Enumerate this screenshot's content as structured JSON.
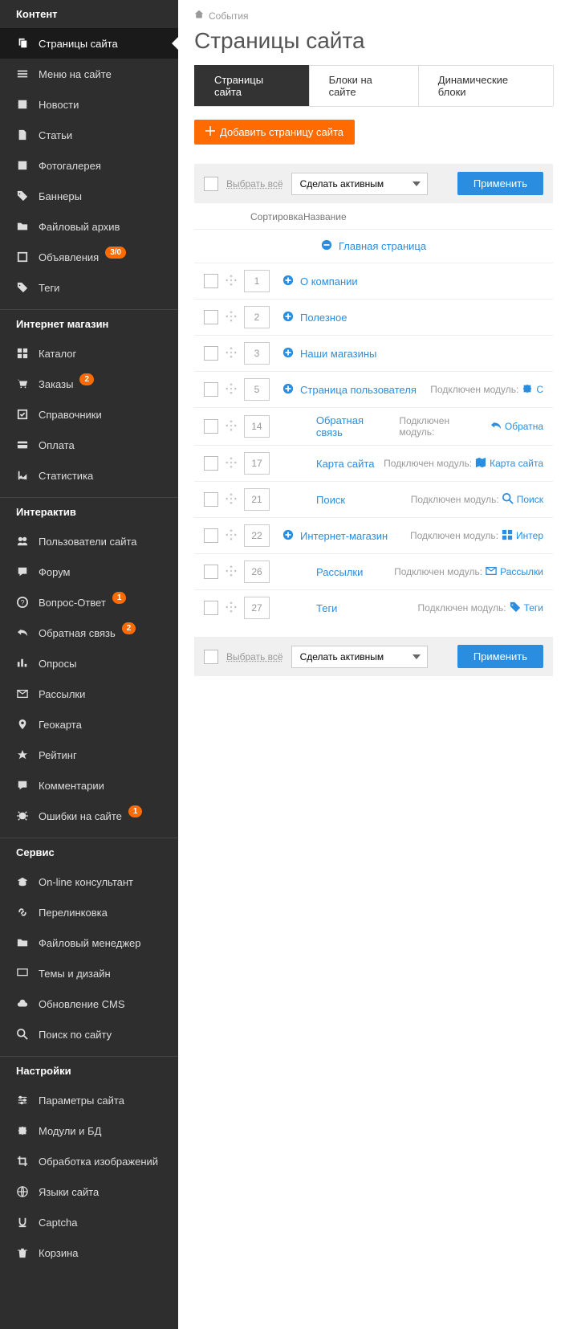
{
  "breadcrumb": "События",
  "page_title": "Страницы сайта",
  "tabs": [
    {
      "label": "Страницы сайта",
      "active": true
    },
    {
      "label": "Блоки на сайте",
      "active": false
    },
    {
      "label": "Динамические блоки",
      "active": false
    }
  ],
  "add_button": "Добавить страницу сайта",
  "select_all": "Выбрать всё",
  "action_select": "Сделать активным",
  "apply": "Применить",
  "th_sort": "Сортировка",
  "th_name": "Название",
  "main_page": "Главная страница",
  "module_prefix": "Подключен модуль:",
  "pages": [
    {
      "sort": "1",
      "name": "О компании",
      "expand": "plus",
      "indent": false
    },
    {
      "sort": "2",
      "name": "Полезное",
      "expand": "plus",
      "indent": false
    },
    {
      "sort": "3",
      "name": "Наши магазины",
      "expand": "plus",
      "indent": false
    },
    {
      "sort": "5",
      "name": "Страница пользователя",
      "expand": "plus",
      "indent": false,
      "module": "С",
      "module_icon": "puzzle"
    },
    {
      "sort": "14",
      "name": "Обратная связь",
      "indent": true,
      "module": "Обратна",
      "module_icon": "reply"
    },
    {
      "sort": "17",
      "name": "Карта сайта",
      "indent": true,
      "module": "Карта сайта",
      "module_icon": "map"
    },
    {
      "sort": "21",
      "name": "Поиск",
      "indent": true,
      "module": "Поиск",
      "module_icon": "search"
    },
    {
      "sort": "22",
      "name": "Интернет-магазин",
      "expand": "plus",
      "indent": false,
      "module": "Интер",
      "module_icon": "grid"
    },
    {
      "sort": "26",
      "name": "Рассылки",
      "indent": true,
      "module": "Рассылки",
      "module_icon": "mail"
    },
    {
      "sort": "27",
      "name": "Теги",
      "indent": true,
      "module": "Теги",
      "module_icon": "tag"
    }
  ],
  "sidebar": [
    {
      "type": "header",
      "label": "Контент"
    },
    {
      "type": "item",
      "label": "Страницы сайта",
      "icon": "copy",
      "active": true
    },
    {
      "type": "item",
      "label": "Меню на сайте",
      "icon": "menu"
    },
    {
      "type": "item",
      "label": "Новости",
      "icon": "news"
    },
    {
      "type": "item",
      "label": "Статьи",
      "icon": "doc"
    },
    {
      "type": "item",
      "label": "Фотогалерея",
      "icon": "image"
    },
    {
      "type": "item",
      "label": "Баннеры",
      "icon": "tag"
    },
    {
      "type": "item",
      "label": "Файловый архив",
      "icon": "folder"
    },
    {
      "type": "item",
      "label": "Объявления",
      "icon": "square",
      "badge": "3/0"
    },
    {
      "type": "item",
      "label": "Теги",
      "icon": "tag"
    },
    {
      "type": "divider"
    },
    {
      "type": "header",
      "label": "Интернет магазин"
    },
    {
      "type": "item",
      "label": "Каталог",
      "icon": "grid"
    },
    {
      "type": "item",
      "label": "Заказы",
      "icon": "cart",
      "badge": "2"
    },
    {
      "type": "item",
      "label": "Справочники",
      "icon": "check"
    },
    {
      "type": "item",
      "label": "Оплата",
      "icon": "card"
    },
    {
      "type": "item",
      "label": "Статистика",
      "icon": "chart"
    },
    {
      "type": "divider"
    },
    {
      "type": "header",
      "label": "Интерактив"
    },
    {
      "type": "item",
      "label": "Пользователи сайта",
      "icon": "users"
    },
    {
      "type": "item",
      "label": "Форум",
      "icon": "comment"
    },
    {
      "type": "item",
      "label": "Вопрос-Ответ",
      "icon": "question",
      "badge": "1"
    },
    {
      "type": "item",
      "label": "Обратная связь",
      "icon": "reply",
      "badge": "2"
    },
    {
      "type": "item",
      "label": "Опросы",
      "icon": "poll"
    },
    {
      "type": "item",
      "label": "Рассылки",
      "icon": "mail"
    },
    {
      "type": "item",
      "label": "Геокарта",
      "icon": "pin"
    },
    {
      "type": "item",
      "label": "Рейтинг",
      "icon": "star"
    },
    {
      "type": "item",
      "label": "Комментарии",
      "icon": "comment"
    },
    {
      "type": "item",
      "label": "Ошибки на сайте",
      "icon": "bug",
      "badge": "1"
    },
    {
      "type": "divider"
    },
    {
      "type": "header",
      "label": "Сервис"
    },
    {
      "type": "item",
      "label": "On-line консультант",
      "icon": "grad"
    },
    {
      "type": "item",
      "label": "Перелинковка",
      "icon": "link"
    },
    {
      "type": "item",
      "label": "Файловый менеджер",
      "icon": "folder"
    },
    {
      "type": "item",
      "label": "Темы и дизайн",
      "icon": "desktop"
    },
    {
      "type": "item",
      "label": "Обновление CMS",
      "icon": "cloud"
    },
    {
      "type": "item",
      "label": "Поиск по сайту",
      "icon": "search"
    },
    {
      "type": "divider"
    },
    {
      "type": "header",
      "label": "Настройки"
    },
    {
      "type": "item",
      "label": "Параметры сайта",
      "icon": "sliders"
    },
    {
      "type": "item",
      "label": "Модули и БД",
      "icon": "puzzle"
    },
    {
      "type": "item",
      "label": "Обработка изображений",
      "icon": "crop"
    },
    {
      "type": "item",
      "label": "Языки сайта",
      "icon": "globe"
    },
    {
      "type": "item",
      "label": "Captcha",
      "icon": "underline"
    },
    {
      "type": "item",
      "label": "Корзина",
      "icon": "trash"
    }
  ]
}
